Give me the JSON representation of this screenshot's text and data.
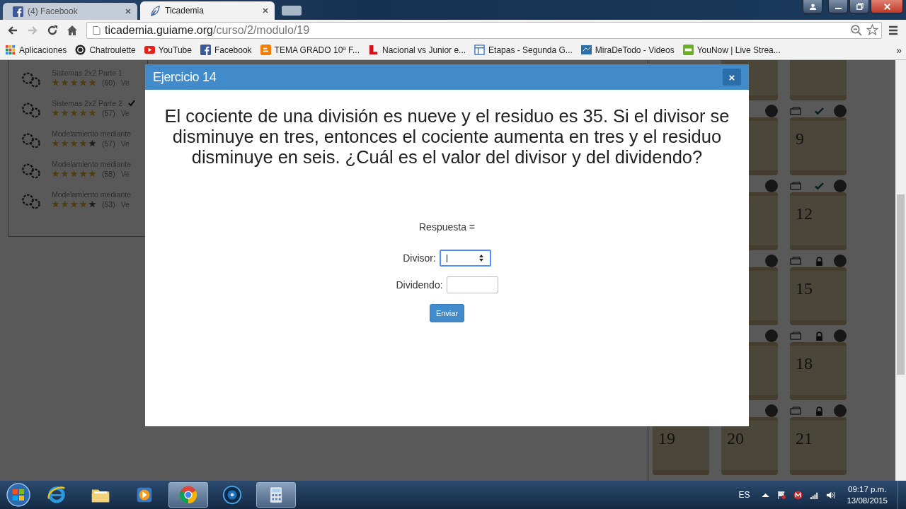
{
  "browser": {
    "tabs": [
      {
        "title": "(4) Facebook",
        "selected": false
      },
      {
        "title": "Ticademia",
        "selected": true
      }
    ],
    "url": {
      "host": "ticademia.guiame.org",
      "path": "/curso/2/modulo/19"
    },
    "bookmarks": [
      {
        "label": "Aplicaciones"
      },
      {
        "label": "Chatroulette"
      },
      {
        "label": "YouTube"
      },
      {
        "label": "Facebook"
      },
      {
        "label": "TEMA GRADO 10º F..."
      },
      {
        "label": "Nacional vs Junior e..."
      },
      {
        "label": "Etapas - Segunda G..."
      },
      {
        "label": "MiraDeTodo - Videos"
      },
      {
        "label": "YouNow | Live Strea..."
      }
    ],
    "bookmarks_more": "»"
  },
  "lessons": [
    {
      "title": "Sistemas 2x2 Parte 1",
      "stars": 5,
      "count": "(60)",
      "link": "Ve",
      "done": false
    },
    {
      "title": "Sistemas 2x2 Parte 2",
      "stars": 5,
      "count": "(57)",
      "link": "Ve",
      "done": true
    },
    {
      "title": "Modelamiento mediante",
      "stars": 4,
      "count": "(57)",
      "link": "Ve",
      "done": false
    },
    {
      "title": "Modelamiento mediante",
      "stars": 5,
      "count": "(58)",
      "link": "Ve",
      "done": false
    },
    {
      "title": "Modelamiento mediante",
      "stars": 4,
      "count": "(53)",
      "link": "Ve",
      "done": false
    }
  ],
  "exercise_rows": [
    [
      null,
      {
        "kind": "plain"
      },
      {
        "kind": "plain"
      }
    ],
    [
      null,
      {
        "kind": "plain"
      },
      {
        "number": "9",
        "kind": "check"
      }
    ],
    [
      null,
      {
        "kind": "plain"
      },
      {
        "number": "12",
        "kind": "check"
      }
    ],
    [
      null,
      {
        "kind": "plain"
      },
      {
        "number": "15",
        "kind": "lock"
      }
    ],
    [
      null,
      {
        "kind": "plain"
      },
      {
        "number": "18",
        "kind": "lock"
      }
    ],
    [
      {
        "number": "19",
        "kind": "plain"
      },
      {
        "number": "20",
        "kind": "plain"
      },
      {
        "number": "21",
        "kind": "lock"
      }
    ]
  ],
  "modal": {
    "title": "Ejercicio 14",
    "close": "×",
    "question": "El cociente de una división es nueve y el residuo es 35. Si el divisor se disminuye en tres, entonces el cociente aumenta en tres y el residuo disminuye en seis. ¿Cuál es el valor del divisor y del dividendo?",
    "answer_label": "Respuesta =",
    "fields": [
      {
        "label": "Divisor:",
        "kind": "number",
        "focused": true
      },
      {
        "label": "Dividendo:",
        "kind": "text",
        "focused": false
      }
    ],
    "submit": "Enviar"
  },
  "taskbar": {
    "apps": [
      {
        "selected": false
      },
      {
        "selected": false
      },
      {
        "selected": false
      },
      {
        "selected": true
      },
      {
        "selected": false
      },
      {
        "selected": true
      }
    ],
    "language": "ES",
    "time": "09:17 p.m.",
    "date": "13/08/2015"
  }
}
